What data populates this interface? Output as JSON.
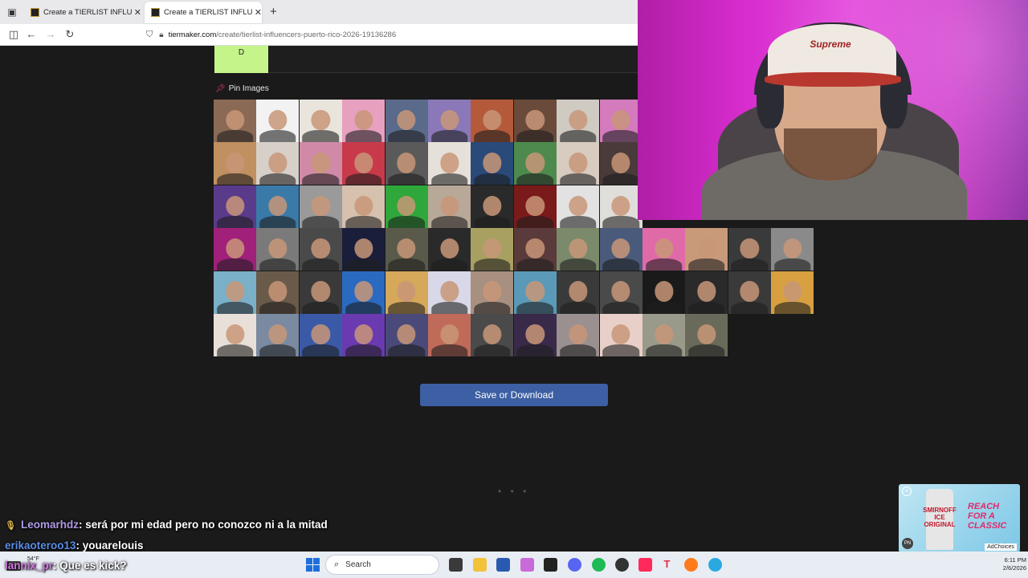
{
  "browser": {
    "tabs": [
      {
        "title": "Create a TIERLIST INFLUENCER",
        "active": false
      },
      {
        "title": "Create a TIERLIST INFLUENCER",
        "active": true
      }
    ],
    "new_tab_label": "+",
    "url_host": "tiermaker.com",
    "url_path": "/create/tierlist-influencers-puerto-rico-2026-19136286"
  },
  "tierlist": {
    "tier_label": "D",
    "tier_color": "#c4f48a",
    "pin_images_label": "Pin Images",
    "save_button_label": "Save or Download",
    "loading_dots": "• • •"
  },
  "image_grid": {
    "rows": [
      [
        "#8a6a55",
        "#f2f2f2",
        "#e9e4dc",
        "#e7a0c0",
        "#5a6a8a",
        "#8a78b8",
        "#b45a3a",
        "#6a4a3a",
        "#cfcac2",
        "#d37bbd"
      ],
      [
        "#c09060",
        "#d6d0c8",
        "#d08aa8",
        "#c83a4a",
        "#5a5a5a",
        "#e6e0da",
        "#2a4a7a",
        "#4e8a4e",
        "#d8cbc0",
        "#4a3a3a"
      ],
      [
        "#5a3a8a",
        "#3a7aa8",
        "#9a9a9a",
        "#d6c0ae",
        "#2ea83a",
        "#b8a898",
        "#2a2a2a",
        "#7a1a1a",
        "#e2e2e2",
        "#e0dedb"
      ],
      [
        "#a0207a",
        "#7a7a7a",
        "#4a4a4a",
        "#1a1e3a",
        "#5a5a4a",
        "#2a2a2a",
        "#a8a060",
        "#5a3a3a",
        "#7a8a6a",
        "#4a5a7a",
        "#e06aa8",
        "#c89a7a",
        "#3a3a3a",
        "#8a8a8a"
      ],
      [
        "#7ab0c8",
        "#6a5a4a",
        "#3a3a3a",
        "#2a6ac0",
        "#d6a85a",
        "#d8d8e8",
        "#a89080",
        "#5a9ab8",
        "#3a3a3a",
        "#4a4a4a",
        "#1a1a1a",
        "#2a2a2a",
        "#3a3a3a",
        "#d8a040"
      ],
      [
        "#e8e0d8",
        "#7a8aa0",
        "#3a5aa8",
        "#6a3ab0",
        "#4a4a7a",
        "#c06a5a",
        "#4a4a4a",
        "#3a2a4a",
        "#9a9090",
        "#e8d0c8",
        "#9a9a8a",
        "#6a6a5a"
      ]
    ]
  },
  "webcam": {
    "cap_text": "Supreme"
  },
  "chat": [
    {
      "user": "Leomarhdz",
      "message": ": será por mi edad pero no conozco ni a la mitad"
    },
    {
      "user": "erikaoteroo13",
      "message": ": youarelouis"
    },
    {
      "user": "lannix_pr",
      "message": ": Que es kick?"
    }
  ],
  "ad": {
    "brand": "SMIRNOFF ICE ORIGINAL",
    "slogan": "REACH FOR A CLASSIC",
    "adchoices": "AdChoices"
  },
  "taskbar": {
    "weather_temp": "54°F",
    "search_placeholder": "Search",
    "time": "6:11 PM",
    "date": "2/6/2026"
  }
}
